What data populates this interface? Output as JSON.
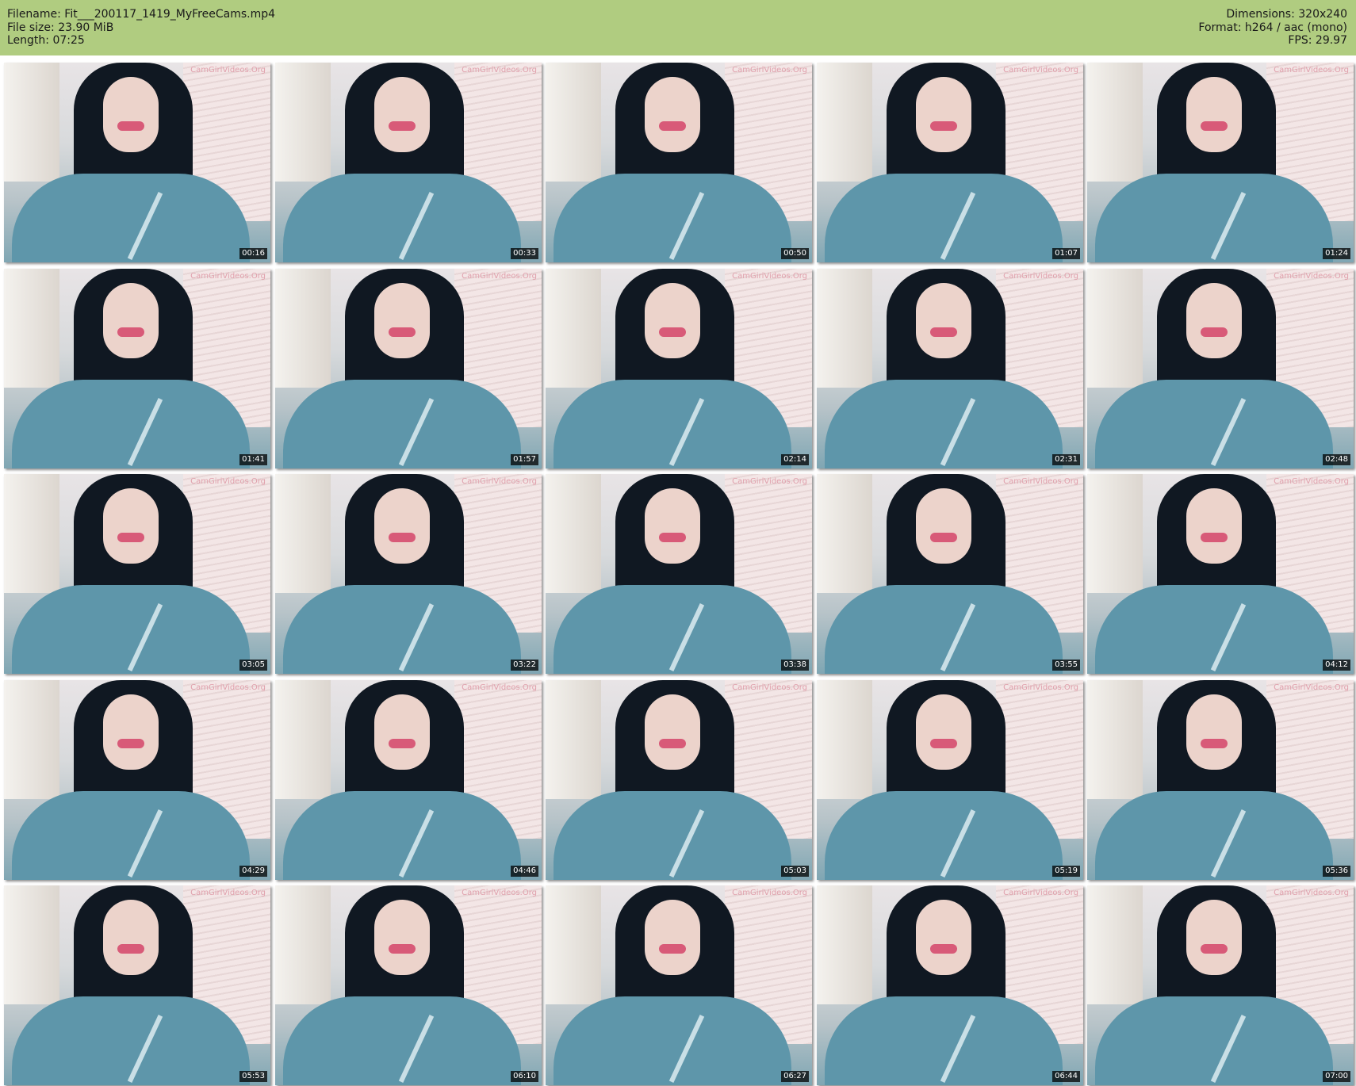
{
  "header": {
    "filename": "Filename: Fit___200117_1419_MyFreeCams.mp4",
    "file_size": "File size: 23.90 MiB",
    "length": "Length: 07:25",
    "dimensions": "Dimensions: 320x240",
    "format": "Format: h264 / aac (mono)",
    "fps": "FPS: 29.97"
  },
  "thumbnails": {
    "watermark": "CamGirlVideos.Org",
    "timestamps": [
      "00:16",
      "00:33",
      "00:50",
      "01:07",
      "01:24",
      "01:41",
      "01:57",
      "02:14",
      "02:31",
      "02:48",
      "03:05",
      "03:22",
      "03:38",
      "03:55",
      "04:12",
      "04:29",
      "04:46",
      "05:03",
      "05:19",
      "05:36",
      "05:53",
      "06:10",
      "06:27",
      "06:44",
      "07:00"
    ]
  },
  "colors": {
    "header_bg": "#b0cc80",
    "page_bg": "#ffffff"
  }
}
